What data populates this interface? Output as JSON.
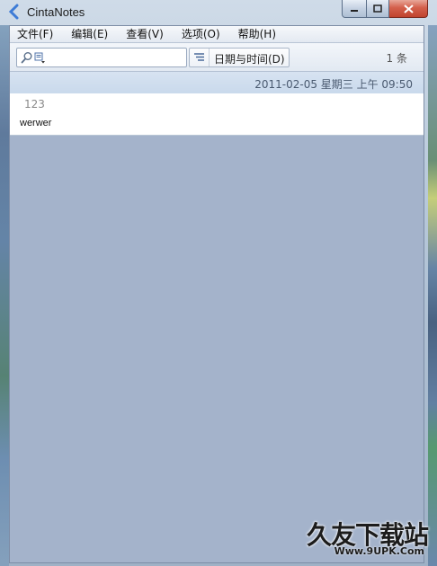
{
  "window": {
    "title": "CintaNotes"
  },
  "menu": {
    "items": [
      {
        "label": "文件(F)"
      },
      {
        "label": "编辑(E)"
      },
      {
        "label": "查看(V)"
      },
      {
        "label": "选项(O)"
      },
      {
        "label": "帮助(H)"
      }
    ]
  },
  "toolbar": {
    "search_value": "",
    "sort_label": "日期与时间(D)",
    "count_label": "1 条"
  },
  "notes": [
    {
      "date": "2011-02-05 星期三 上午 09:50",
      "title": "123",
      "text": "werwer"
    }
  ],
  "watermark": {
    "main": "久友下载站",
    "url": "Www.9UPK.Com"
  }
}
